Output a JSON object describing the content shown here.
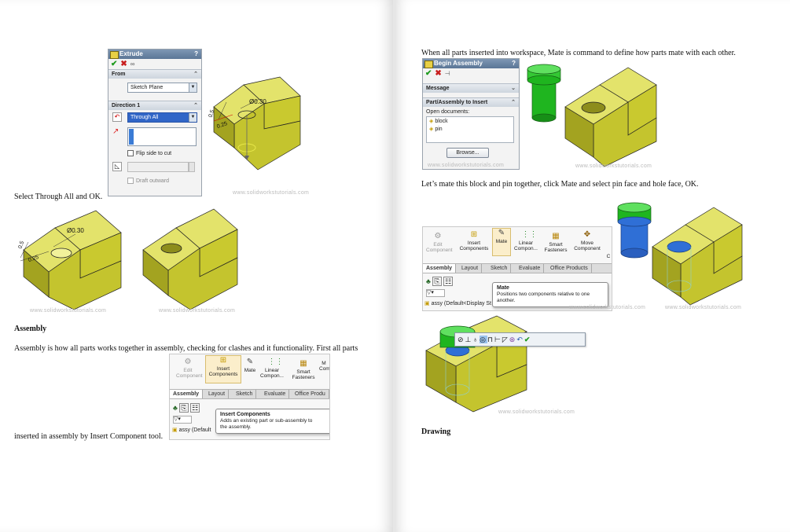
{
  "left": {
    "extrude_panel": {
      "title": "Extrude",
      "help": "?",
      "from_section": "From",
      "from_value": "Sketch Plane",
      "direction_section": "Direction 1",
      "direction_value": "Through All",
      "flip_side_label": "Flip side to cut",
      "draft_label": "Draft outward"
    },
    "caption_select": "Select Through All and OK.",
    "dimension_diameter": "Ø0.30",
    "dimension_a": "0.5",
    "dimension_b": "0.25",
    "watermark": "www.solidworkstutorials.com",
    "heading_assembly": "Assembly",
    "para_assembly_1": "Assembly is how all parts works together in assembly, checking for clashes and it functionality. First all parts",
    "para_assembly_2": "inserted in assembly by Insert Component tool.",
    "command_manager": {
      "edit_component": "Edit Component",
      "insert_components": "Insert Components",
      "mate": "Mate",
      "linear_component": "Linear Compon...",
      "smart_fasteners": "Smart Fasteners",
      "truncated": "M Com",
      "tabs": [
        "Assembly",
        "Layout",
        "Sketch",
        "Evaluate",
        "Office Produ"
      ],
      "tooltip_title": "Insert Components",
      "tooltip_text_1": "Adds an existing part or sub-assembly to",
      "tooltip_text_2": "the assembly.",
      "tree_item": "assy  (Default"
    }
  },
  "right": {
    "para_mate_intro": "When all parts inserted into workspace, Mate is command to define how parts mate with each other.",
    "begin_assembly": {
      "title": "Begin Assembly",
      "help": "?",
      "message_section": "Message",
      "part_section": "Part/Assembly to Insert",
      "open_documents_label": "Open documents:",
      "documents": [
        "block",
        "pin"
      ],
      "browse_button": "Browse..."
    },
    "para_mate_select": "Let’s mate this block and pin together, click Mate and select pin face and hole face, OK.",
    "command_manager": {
      "edit_component": "Edit Component",
      "insert_components": "Insert Components",
      "mate": "Mate",
      "linear_component": "Linear Compon...",
      "smart_fasteners": "Smart Fasteners",
      "move_component": "Move Component",
      "truncated": "C",
      "tabs": [
        "Assembly",
        "Layout",
        "Sketch",
        "Evaluate",
        "Office Products"
      ],
      "tooltip_title": "Mate",
      "tooltip_text_1": "Positions two components relative to one",
      "tooltip_text_2": "another.",
      "tree_item": "assy  (Default<Display St"
    },
    "watermark": "www.solidworkstutorials.com",
    "heading_drawing": "Drawing"
  },
  "colors": {
    "block_top": "#e3e36b",
    "block_front": "#c4c42e",
    "block_side": "#9f9f1e",
    "pin_green": "#1fb51f",
    "pin_blue": "#2f6fd6"
  }
}
